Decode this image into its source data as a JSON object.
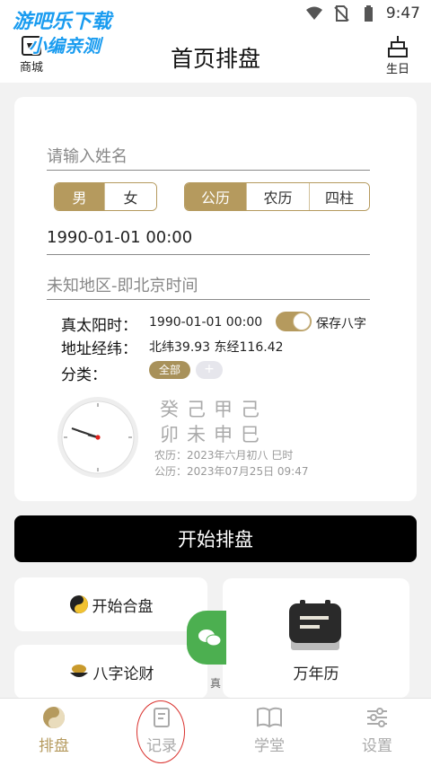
{
  "status": {
    "time": "9:47"
  },
  "watermark": {
    "line1": "游吧乐下载",
    "line2": "小编亲测"
  },
  "header": {
    "title": "首页排盘",
    "left_label": "商城",
    "right_label": "生日"
  },
  "form": {
    "name_placeholder": "请输入姓名",
    "gender": {
      "options": [
        "男",
        "女"
      ],
      "selected": "男"
    },
    "calendar": {
      "options": [
        "公历",
        "农历",
        "四柱"
      ],
      "selected": "公历"
    },
    "datetime": "1990-01-01 00:00",
    "location_placeholder": "未知地区-即北京时间",
    "true_solar_label": "真太阳时：",
    "true_solar_value": "1990-01-01 00:00",
    "save_bazi_label": "保存八字",
    "save_bazi_on": true,
    "coord_label": "地址经纬：",
    "coord_value": "北纬39.93 东经116.42",
    "category_label": "分类：",
    "category_chip": "全部",
    "category_add": "+"
  },
  "bazi": {
    "stems": "癸己甲己",
    "branches": "卯未申巳",
    "lunar": "农历：2023年六月初八 巳时",
    "solar": "公历：2023年07月25日 09:47"
  },
  "start_button": "开始排盘",
  "tiles": {
    "hepan": "开始合盘",
    "lunzai": "八字论财",
    "wannianli": "万年历",
    "peek": "真"
  },
  "bottom_nav": [
    {
      "label": "排盘",
      "icon": "yin-yang-icon",
      "active": true
    },
    {
      "label": "记录",
      "icon": "record-icon",
      "active": false
    },
    {
      "label": "学堂",
      "icon": "book-icon",
      "active": false
    },
    {
      "label": "设置",
      "icon": "settings-icon",
      "active": false
    }
  ],
  "colors": {
    "accent": "#b59a5e",
    "button": "#000000"
  }
}
